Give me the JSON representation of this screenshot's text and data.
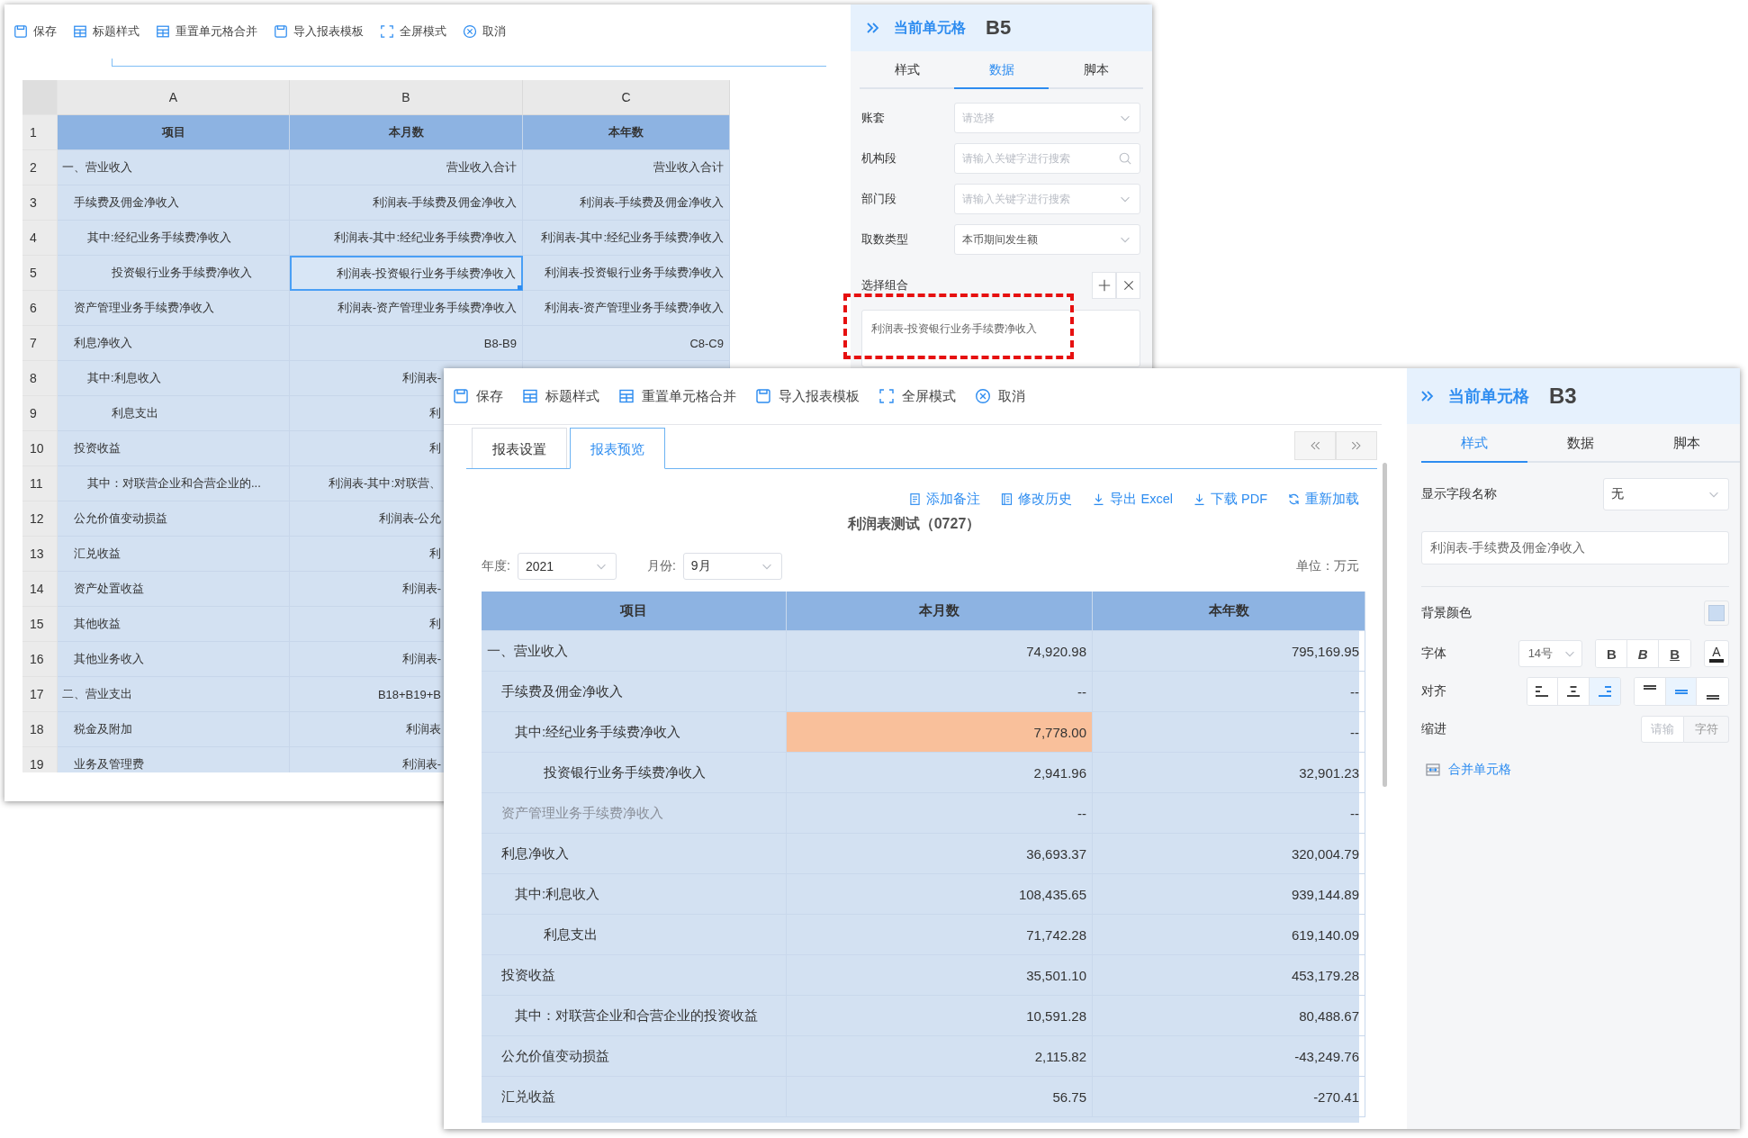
{
  "back_window": {
    "toolbar": [
      {
        "label": "保存",
        "kind": "save"
      },
      {
        "label": "标题样式",
        "kind": "table"
      },
      {
        "label": "重置单元格合并",
        "kind": "table"
      },
      {
        "label": "导入报表模板",
        "kind": "save"
      },
      {
        "label": "全屏模式",
        "kind": "fullscreen"
      },
      {
        "label": "取消",
        "kind": "cancel"
      }
    ],
    "sheet": {
      "column_letters": [
        "A",
        "B",
        "C"
      ],
      "header_row": {
        "row_number": "1",
        "cells": [
          "项目",
          "本月数",
          "本年数"
        ]
      },
      "rows": [
        {
          "row_number": "2",
          "label": "一、营业收入",
          "cells": [
            {
              "text": "营业收入合计",
              "selected": false
            },
            {
              "text": "营业收入合计",
              "selected": false
            }
          ],
          "children": [
            {
              "row_number": "3",
              "label": "手续费及佣金净收入",
              "cells": [
                {
                  "text": "利润表-手续费及佣金净收入",
                  "selected": false
                },
                {
                  "text": "利润表-手续费及佣金净收入",
                  "selected": false
                }
              ],
              "children": [
                {
                  "row_number": "4",
                  "label": "其中:经纪业务手续费净收入",
                  "cells": [
                    {
                      "text": "利润表-其中:经纪业务手续费净收入",
                      "selected": false
                    },
                    {
                      "text": "利润表-其中:经纪业务手续费净收入",
                      "selected": false
                    }
                  ],
                  "children": [
                    {
                      "row_number": "5",
                      "label": "投资银行业务手续费净收入",
                      "cells": [
                        {
                          "text": "利润表-投资银行业务手续费净收入",
                          "selected": true
                        },
                        {
                          "text": "利润表-投资银行业务手续费净收入",
                          "selected": false
                        }
                      ]
                    }
                  ]
                }
              ]
            },
            {
              "row_number": "6",
              "label": "资产管理业务手续费净收入",
              "cells": [
                {
                  "text": "利润表-资产管理业务手续费净收入",
                  "selected": false
                },
                {
                  "text": "利润表-资产管理业务手续费净收入",
                  "selected": false
                }
              ]
            },
            {
              "row_number": "7",
              "label": "利息净收入",
              "cells": [
                {
                  "text": "B8-B9",
                  "selected": false
                },
                {
                  "text": "C8-C9",
                  "selected": false
                }
              ],
              "children": [
                {
                  "row_number": "8",
                  "label": "其中:利息收入",
                  "cells": [
                    {
                      "text": "利润表-",
                      "selected": false
                    }
                  ],
                  "children": [
                    {
                      "row_number": "9",
                      "label": "利息支出",
                      "cells": [
                        {
                          "text": "利",
                          "selected": false
                        }
                      ]
                    }
                  ]
                }
              ]
            },
            {
              "row_number": "10",
              "label": "投资收益",
              "cells": [
                {
                  "text": "利",
                  "selected": false
                }
              ],
              "children": [
                {
                  "row_number": "11",
                  "label": "其中：对联营企业和合营企业的...",
                  "cells": [
                    {
                      "text": "利润表-其中:对联营、",
                      "selected": false
                    }
                  ]
                }
              ]
            },
            {
              "row_number": "12",
              "label": "公允价值变动损益",
              "cells": [
                {
                  "text": "利润表-公允",
                  "selected": false
                }
              ]
            },
            {
              "row_number": "13",
              "label": "汇兑收益",
              "cells": [
                {
                  "text": "利",
                  "selected": false
                }
              ]
            },
            {
              "row_number": "14",
              "label": "资产处置收益",
              "cells": [
                {
                  "text": "利润表-",
                  "selected": false
                }
              ]
            },
            {
              "row_number": "15",
              "label": "其他收益",
              "cells": [
                {
                  "text": "利",
                  "selected": false
                }
              ]
            },
            {
              "row_number": "16",
              "label": "其他业务收入",
              "cells": [
                {
                  "text": "利润表-",
                  "selected": false
                }
              ]
            }
          ]
        },
        {
          "row_number": "17",
          "label": "二、营业支出",
          "cells": [
            {
              "text": "B18+B19+B",
              "selected": false
            }
          ],
          "children": [
            {
              "row_number": "18",
              "label": "税金及附加",
              "cells": [
                {
                  "text": "利润表",
                  "selected": false
                }
              ]
            },
            {
              "row_number": "19",
              "label": "业务及管理费",
              "cells": [
                {
                  "text": "利润表-",
                  "selected": false
                }
              ]
            }
          ]
        }
      ]
    },
    "panel": {
      "title": "当前单元格",
      "cell": "B5",
      "tabs": [
        {
          "label": "样式",
          "selected": false
        },
        {
          "label": "数据",
          "selected": true
        },
        {
          "label": "脚本",
          "selected": false
        }
      ],
      "fields": [
        {
          "label": "账套",
          "placeholder": "请选择",
          "kind": "select"
        },
        {
          "label": "机构段",
          "placeholder": "请输入关键字进行搜索",
          "kind": "search"
        },
        {
          "label": "部门段",
          "placeholder": "请输入关键字进行搜索",
          "kind": "select"
        },
        {
          "label": "取数类型",
          "value": "本币期间发生额",
          "kind": "select"
        }
      ],
      "combination": {
        "label": "选择组合",
        "value": "利润表-投资银行业务手续费净收入"
      }
    }
  },
  "front_window": {
    "toolbar": [
      {
        "label": "保存",
        "kind": "save"
      },
      {
        "label": "标题样式",
        "kind": "table"
      },
      {
        "label": "重置单元格合并",
        "kind": "table"
      },
      {
        "label": "导入报表模板",
        "kind": "save"
      },
      {
        "label": "全屏模式",
        "kind": "fullscreen"
      },
      {
        "label": "取消",
        "kind": "cancel"
      }
    ],
    "tabs": [
      {
        "label": "报表设置",
        "selected": false
      },
      {
        "label": "报表预览",
        "selected": true
      }
    ],
    "actions": [
      {
        "label": "添加备注",
        "kind": "note"
      },
      {
        "label": "修改历史",
        "kind": "history"
      },
      {
        "label": "导出 Excel",
        "kind": "download"
      },
      {
        "label": "下载 PDF",
        "kind": "download"
      },
      {
        "label": "重新加载",
        "kind": "reload"
      }
    ],
    "report_title": "利润表测试（0727）",
    "filters": [
      {
        "label": "年度:",
        "value": "2021"
      },
      {
        "label": "月份:",
        "value": "9月"
      }
    ],
    "unit": "单位：万元",
    "table": {
      "columns": [
        "项目",
        "本月数",
        "本年数"
      ],
      "rows": [
        {
          "item": "一、营业收入",
          "muted": false,
          "cells": [
            {
              "text": "74,920.98",
              "highlighted": false
            },
            {
              "text": "795,169.95",
              "highlighted": false
            }
          ],
          "children": [
            {
              "item": "手续费及佣金净收入",
              "muted": false,
              "cells": [
                {
                  "text": "--",
                  "highlighted": false
                },
                {
                  "text": "--",
                  "highlighted": false
                }
              ],
              "children": [
                {
                  "item": "其中:经纪业务手续费净收入",
                  "muted": false,
                  "cells": [
                    {
                      "text": "7,778.00",
                      "highlighted": true
                    },
                    {
                      "text": "--",
                      "highlighted": false
                    }
                  ],
                  "children": [
                    {
                      "item": "投资银行业务手续费净收入",
                      "muted": false,
                      "cells": [
                        {
                          "text": "2,941.96",
                          "highlighted": false
                        },
                        {
                          "text": "32,901.23",
                          "highlighted": false
                        }
                      ]
                    }
                  ]
                }
              ]
            },
            {
              "item": "资产管理业务手续费净收入",
              "muted": true,
              "cells": [
                {
                  "text": "--",
                  "highlighted": false
                },
                {
                  "text": "--",
                  "highlighted": false
                }
              ]
            },
            {
              "item": "利息净收入",
              "muted": false,
              "cells": [
                {
                  "text": "36,693.37",
                  "highlighted": false
                },
                {
                  "text": "320,004.79",
                  "highlighted": false
                }
              ],
              "children": [
                {
                  "item": "其中:利息收入",
                  "muted": false,
                  "cells": [
                    {
                      "text": "108,435.65",
                      "highlighted": false
                    },
                    {
                      "text": "939,144.89",
                      "highlighted": false
                    }
                  ],
                  "children": [
                    {
                      "item": "利息支出",
                      "muted": false,
                      "cells": [
                        {
                          "text": "71,742.28",
                          "highlighted": false
                        },
                        {
                          "text": "619,140.09",
                          "highlighted": false
                        }
                      ]
                    }
                  ]
                }
              ]
            },
            {
              "item": "投资收益",
              "muted": false,
              "cells": [
                {
                  "text": "35,501.10",
                  "highlighted": false
                },
                {
                  "text": "453,179.28",
                  "highlighted": false
                }
              ],
              "children": [
                {
                  "item": "其中：对联营企业和合营企业的投资收益",
                  "muted": false,
                  "cells": [
                    {
                      "text": "10,591.28",
                      "highlighted": false
                    },
                    {
                      "text": "80,488.67",
                      "highlighted": false
                    }
                  ]
                }
              ]
            },
            {
              "item": "公允价值变动损益",
              "muted": false,
              "cells": [
                {
                  "text": "2,115.82",
                  "highlighted": false
                },
                {
                  "text": "-43,249.76",
                  "highlighted": false
                }
              ]
            },
            {
              "item": "汇兑收益",
              "muted": false,
              "cells": [
                {
                  "text": "56.75",
                  "highlighted": false
                },
                {
                  "text": "-270.41",
                  "highlighted": false
                }
              ]
            }
          ]
        }
      ]
    },
    "panel": {
      "title": "当前单元格",
      "cell": "B3",
      "tabs": [
        {
          "label": "样式",
          "selected": true
        },
        {
          "label": "数据",
          "selected": false
        },
        {
          "label": "脚本",
          "selected": false
        }
      ],
      "display_field": {
        "label": "显示字段名称",
        "value": "无"
      },
      "field_value": "利润表-手续费及佣金净收入",
      "background_label": "背景颜色",
      "font": {
        "label": "字体",
        "size": "14号",
        "styles": [
          {
            "text": "B",
            "kind": "bold"
          },
          {
            "text": "B",
            "kind": "italic"
          },
          {
            "text": "B",
            "kind": "underline"
          }
        ],
        "color_button": "A"
      },
      "align": {
        "label": "对齐",
        "horizontal": [
          {
            "kind": "left",
            "selected": false
          },
          {
            "kind": "center",
            "selected": false
          },
          {
            "kind": "right",
            "selected": true
          }
        ],
        "vertical": [
          {
            "kind": "top",
            "selected": false
          },
          {
            "kind": "middle",
            "selected": true
          },
          {
            "kind": "bottom",
            "selected": false
          }
        ]
      },
      "indent": {
        "label": "缩进",
        "placeholder": "请输",
        "unit": "字符"
      },
      "merge_link": "合并单元格"
    }
  }
}
